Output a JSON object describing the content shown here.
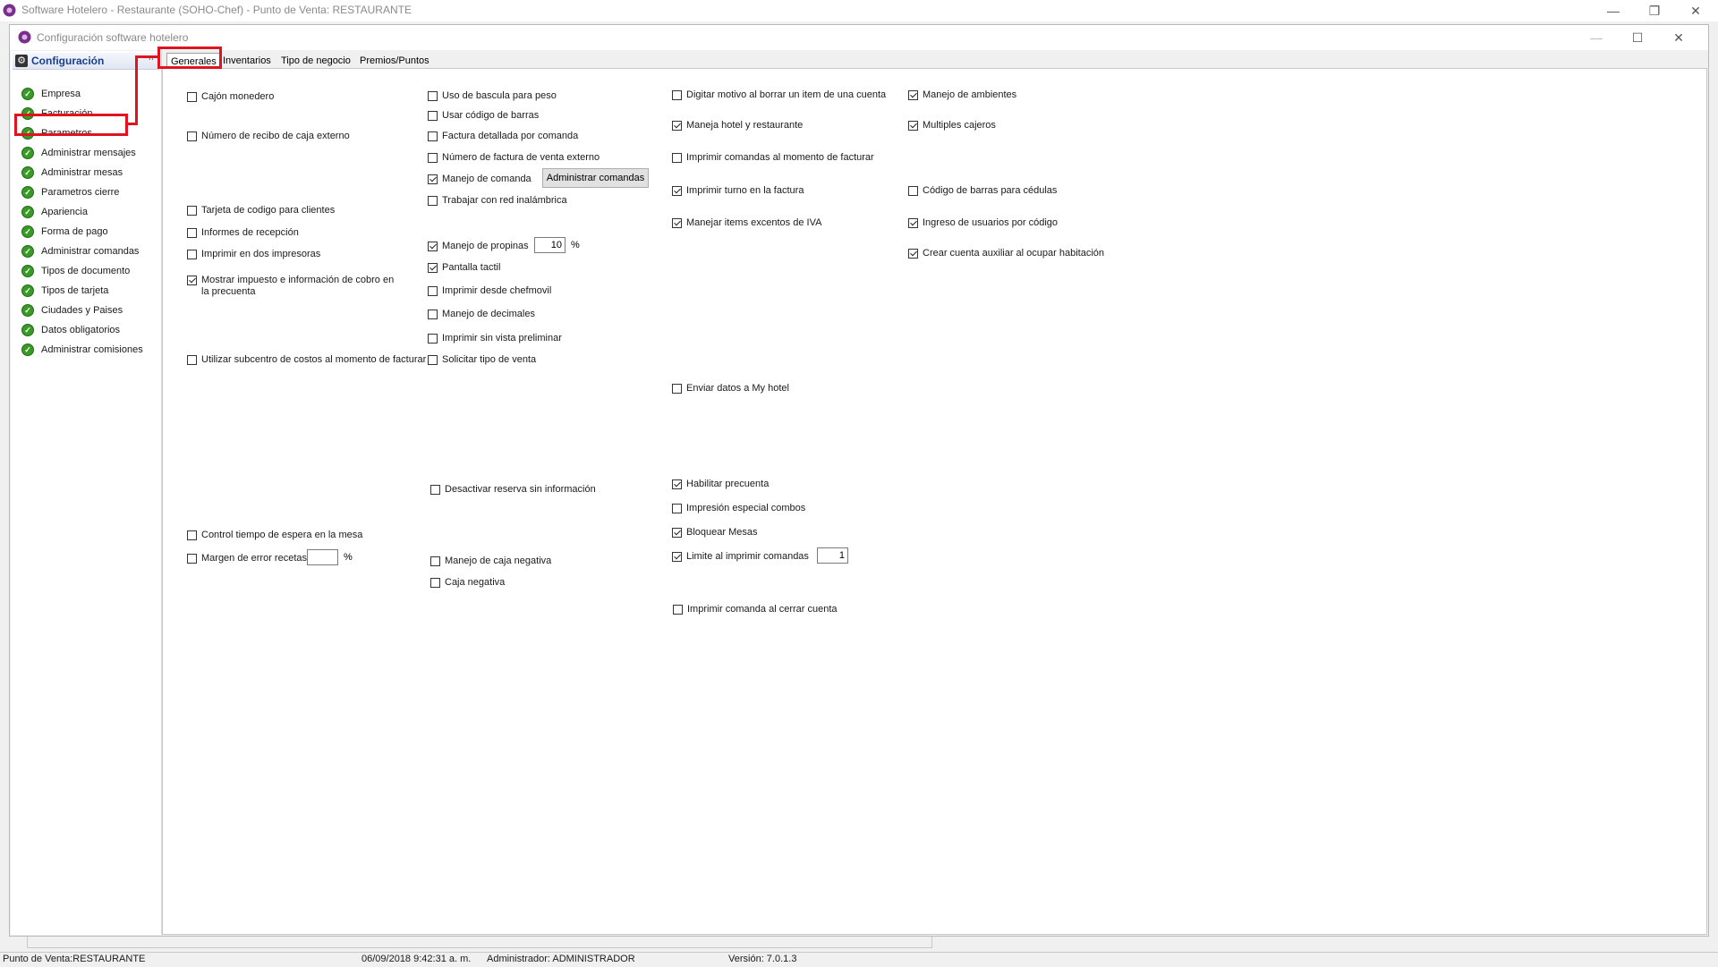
{
  "app": {
    "title": "Software  Hotelero - Restaurante (SOHO-Chef)  - Punto de Venta: RESTAURANTE"
  },
  "config_window": {
    "title": "Configuración software hotelero"
  },
  "nav": {
    "header": "Configuración",
    "items": [
      {
        "label": "Empresa"
      },
      {
        "label": "Facturación"
      },
      {
        "label": "Parametros"
      },
      {
        "label": "Administrar mensajes"
      },
      {
        "label": "Administrar mesas"
      },
      {
        "label": "Parametros cierre"
      },
      {
        "label": "Apariencia"
      },
      {
        "label": "Forma de pago"
      },
      {
        "label": "Administrar comandas"
      },
      {
        "label": "Tipos de documento"
      },
      {
        "label": "Tipos de tarjeta"
      },
      {
        "label": "Ciudades y Paises"
      },
      {
        "label": "Datos obligatorios"
      },
      {
        "label": "Administrar comisiones"
      }
    ]
  },
  "tabs": [
    {
      "label": "Generales"
    },
    {
      "label": "Inventarios"
    },
    {
      "label": "Tipo de negocio"
    },
    {
      "label": "Premios/Puntos"
    }
  ],
  "options": {
    "col1": [
      {
        "label": "Cajón monedero",
        "checked": false
      },
      {
        "label": "Número de recibo de caja externo",
        "checked": false
      },
      {
        "label": "Tarjeta de codigo para clientes",
        "checked": false
      },
      {
        "label": "Informes de recepción",
        "checked": false
      },
      {
        "label": "Imprimir en dos impresoras",
        "checked": false
      },
      {
        "label": "Mostrar impuesto e información de cobro en la precuenta",
        "checked": true
      },
      {
        "label": "Utilizar subcentro de costos al momento de facturar",
        "checked": false
      },
      {
        "label": "Control tiempo de espera en la mesa",
        "checked": false
      },
      {
        "label": "Margen de error recetas",
        "checked": false
      }
    ],
    "col2": [
      {
        "label": "Uso de bascula para peso",
        "checked": false
      },
      {
        "label": "Usar código de barras",
        "checked": false
      },
      {
        "label": "Factura detallada por comanda",
        "checked": false
      },
      {
        "label": "Número de factura de venta externo",
        "checked": false
      },
      {
        "label": "Manejo de comanda",
        "checked": true
      },
      {
        "label": "Trabajar con red inalámbrica",
        "checked": false
      },
      {
        "label": "Manejo de propinas",
        "checked": true
      },
      {
        "label": "Pantalla tactil",
        "checked": true
      },
      {
        "label": "Imprimir desde chefmovil",
        "checked": false
      },
      {
        "label": "Manejo de decimales",
        "checked": false
      },
      {
        "label": "Imprimir sin vista preliminar",
        "checked": false
      },
      {
        "label": "Solicitar tipo de venta",
        "checked": false
      },
      {
        "label": "Desactivar reserva sin información",
        "checked": false
      },
      {
        "label": "Manejo de caja negativa",
        "checked": false
      },
      {
        "label": "Caja negativa",
        "checked": false
      }
    ],
    "col3": [
      {
        "label": "Digitar motivo al borrar un item de una cuenta",
        "checked": false
      },
      {
        "label": "Maneja hotel y restaurante",
        "checked": true
      },
      {
        "label": "Imprimir comandas al momento de facturar",
        "checked": false
      },
      {
        "label": "Imprimir turno en la factura",
        "checked": true
      },
      {
        "label": "Manejar items excentos de IVA",
        "checked": true
      },
      {
        "label": "Enviar datos a My hotel",
        "checked": false
      },
      {
        "label": "Habilitar precuenta",
        "checked": true
      },
      {
        "label": "Impresión especial combos",
        "checked": false
      },
      {
        "label": "Bloquear Mesas",
        "checked": true
      },
      {
        "label": "Limite al imprimir comandas",
        "checked": true
      },
      {
        "label": "Imprimir comanda al cerrar cuenta",
        "checked": false
      }
    ],
    "col4": [
      {
        "label": "Manejo de ambientes",
        "checked": true
      },
      {
        "label": "Multiples cajeros",
        "checked": true
      },
      {
        "label": "Código de barras para cédulas",
        "checked": false
      },
      {
        "label": "Ingreso de usuarios por código",
        "checked": true
      },
      {
        "label": "Crear cuenta auxiliar al ocupar habitación",
        "checked": true
      }
    ]
  },
  "fields": {
    "propinas_value": "10",
    "propinas_unit": "%",
    "margen_value": "",
    "margen_unit": "%",
    "limite_value": "1",
    "admin_comandas_button": "Administrar comandas"
  },
  "status": {
    "punto": "Punto de Venta:RESTAURANTE",
    "datetime": "06/09/2018 9:42:31 a. m.",
    "user": "Administrador: ADMINISTRADOR",
    "version": "Versión: 7.0.1.3"
  },
  "colors": {
    "annotation": "#e0141e",
    "ok_icon": "#3a9a28",
    "nav_header_text": "#1a3e8a"
  }
}
